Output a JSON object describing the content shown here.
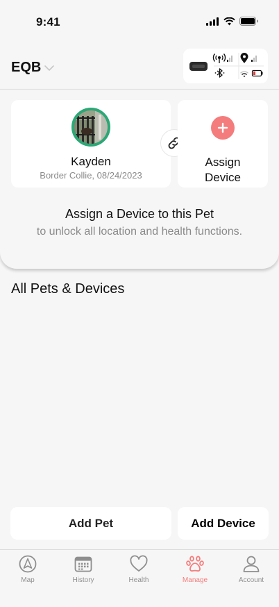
{
  "status_bar": {
    "time": "9:41"
  },
  "header": {
    "group_name": "EQB"
  },
  "pet": {
    "name": "Kayden",
    "details": "Border Collie, 08/24/2023"
  },
  "assign_card": {
    "label_line1": "Assign",
    "label_line2": "Device"
  },
  "prompt": {
    "title": "Assign a Device to this Pet",
    "subtitle": "to unlock all location and health functions."
  },
  "section": {
    "title": "All Pets & Devices"
  },
  "buttons": {
    "add_pet": "Add Pet",
    "add_device": "Add Device"
  },
  "tabs": [
    {
      "label": "Map",
      "icon": "navigation-arrow-icon"
    },
    {
      "label": "History",
      "icon": "calendar-icon"
    },
    {
      "label": "Health",
      "icon": "heart-icon"
    },
    {
      "label": "Manage",
      "icon": "paw-icon",
      "active": true
    },
    {
      "label": "Account",
      "icon": "person-icon"
    }
  ],
  "colors": {
    "accent": "#f47c7c",
    "avatar_ring": "#2aa876",
    "battery": "#e53935"
  }
}
